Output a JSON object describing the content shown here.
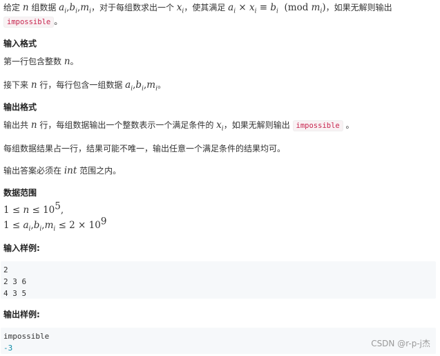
{
  "intro": {
    "t1": "给定 ",
    "v_n": "n",
    "t2": " 组数据 ",
    "v_abm": "a",
    "t3": "，对于每组数求出一个 ",
    "v_x": "x",
    "t4": "，使其满足 ",
    "eq_mod": "mod",
    "t5": "，如果无解则输出",
    "impossible_tag": "impossible",
    "end": "。"
  },
  "input_format": {
    "heading": "输入格式",
    "line1_a": "第一行包含整数 ",
    "line1_var": "n",
    "line1_end": "。",
    "line2_a": "接下来 ",
    "line2_var": "n",
    "line2_b": " 行，每行包含一组数据 ",
    "line2_end": "。"
  },
  "output_format": {
    "heading": "输出格式",
    "line1_a": "输出共 ",
    "line1_var": "n",
    "line1_b": " 行，每组数据输出一个整数表示一个满足条件的 ",
    "line1_c": "，如果无解则输出 ",
    "impossible_tag": "impossible",
    "line1_end": " 。",
    "line2": "每组数据结果占一行，结果可能不唯一，输出任意一个满足条件的结果均可。",
    "line3_a": "输出答案必须在 ",
    "line3_var": "int",
    "line3_b": " 范围之内。"
  },
  "data_range": {
    "heading": "数据范围"
  },
  "sample_input": {
    "heading": "输入样例:",
    "lines": [
      "2",
      "2 3 6",
      "4 3 5"
    ]
  },
  "sample_output": {
    "heading": "输出样例:",
    "lines": [
      "impossible",
      "-3"
    ]
  },
  "watermark": "CSDN @r-p-j杰"
}
